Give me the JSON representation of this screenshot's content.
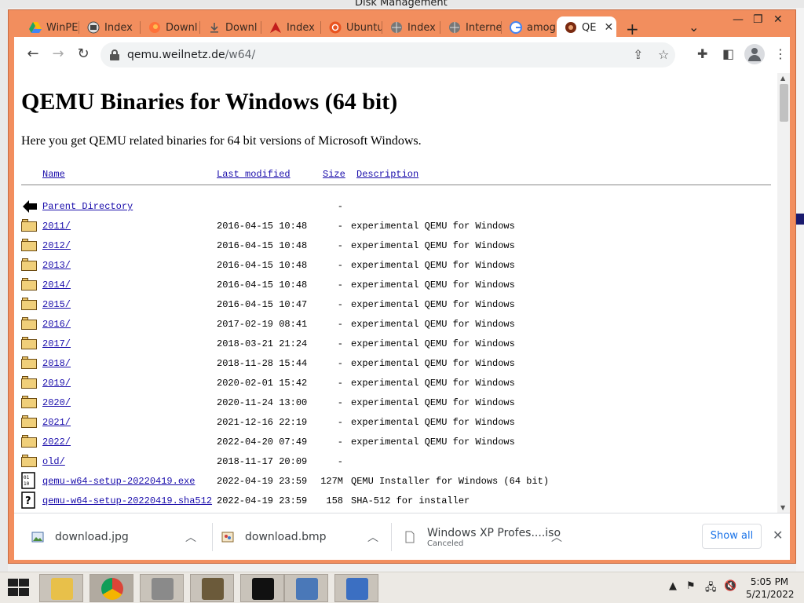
{
  "background_window": {
    "title": "Disk Management"
  },
  "browser": {
    "tabs": [
      {
        "label": "WinPE",
        "icon": "google-drive-icon"
      },
      {
        "label": "Index",
        "icon": "index-page-icon"
      },
      {
        "label": "Downl",
        "icon": "firefox-icon"
      },
      {
        "label": "Downl",
        "icon": "download-icon"
      },
      {
        "label": "Index",
        "icon": "arch-icon"
      },
      {
        "label": "Ubuntu",
        "icon": "ubuntu-icon"
      },
      {
        "label": "Index",
        "icon": "globe-icon"
      },
      {
        "label": "Interne",
        "icon": "globe-icon"
      },
      {
        "label": "amog",
        "icon": "google-icon"
      },
      {
        "label": "QE",
        "icon": "qemu-icon",
        "active": true
      }
    ],
    "address": {
      "host": "qemu.weilnetz.de",
      "path": "/w64/"
    }
  },
  "page": {
    "title": "QEMU Binaries for Windows (64 bit)",
    "intro": "Here you get QEMU related binaries for 64 bit versions of Microsoft Windows.",
    "columns": {
      "name": "Name",
      "modified": "Last modified",
      "size": "Size",
      "description": "Description"
    },
    "entries": [
      {
        "name": "Parent Directory",
        "date": "",
        "size": "-",
        "desc": "",
        "icon": "back-icon"
      },
      {
        "name": "2011/",
        "date": "2016-04-15 10:48",
        "size": "-",
        "desc": "experimental QEMU for Windows",
        "icon": "folder-icon"
      },
      {
        "name": "2012/",
        "date": "2016-04-15 10:48",
        "size": "-",
        "desc": "experimental QEMU for Windows",
        "icon": "folder-icon"
      },
      {
        "name": "2013/",
        "date": "2016-04-15 10:48",
        "size": "-",
        "desc": "experimental QEMU for Windows",
        "icon": "folder-icon"
      },
      {
        "name": "2014/",
        "date": "2016-04-15 10:48",
        "size": "-",
        "desc": "experimental QEMU for Windows",
        "icon": "folder-icon"
      },
      {
        "name": "2015/",
        "date": "2016-04-15 10:47",
        "size": "-",
        "desc": "experimental QEMU for Windows",
        "icon": "folder-icon"
      },
      {
        "name": "2016/",
        "date": "2017-02-19 08:41",
        "size": "-",
        "desc": "experimental QEMU for Windows",
        "icon": "folder-icon"
      },
      {
        "name": "2017/",
        "date": "2018-03-21 21:24",
        "size": "-",
        "desc": "experimental QEMU for Windows",
        "icon": "folder-icon"
      },
      {
        "name": "2018/",
        "date": "2018-11-28 15:44",
        "size": "-",
        "desc": "experimental QEMU for Windows",
        "icon": "folder-icon"
      },
      {
        "name": "2019/",
        "date": "2020-02-01 15:42",
        "size": "-",
        "desc": "experimental QEMU for Windows",
        "icon": "folder-icon"
      },
      {
        "name": "2020/",
        "date": "2020-11-24 13:00",
        "size": "-",
        "desc": "experimental QEMU for Windows",
        "icon": "folder-icon"
      },
      {
        "name": "2021/",
        "date": "2021-12-16 22:19",
        "size": "-",
        "desc": "experimental QEMU for Windows",
        "icon": "folder-icon"
      },
      {
        "name": "2022/",
        "date": "2022-04-20 07:49",
        "size": "-",
        "desc": "experimental QEMU for Windows",
        "icon": "folder-icon"
      },
      {
        "name": "old/",
        "date": "2018-11-17 20:09",
        "size": "-",
        "desc": "",
        "icon": "folder-icon"
      },
      {
        "name": "qemu-w64-setup-20220419.exe",
        "date": "2022-04-19 23:59",
        "size": "127M",
        "desc": "QEMU Installer for Windows (64 bit)",
        "icon": "binary-file-icon"
      },
      {
        "name": "qemu-w64-setup-20220419.sha512",
        "date": "2022-04-19 23:59",
        "size": "158",
        "desc": "SHA-512 for installer",
        "icon": "unknown-file-icon"
      }
    ]
  },
  "downloads": {
    "items": [
      {
        "filename": "download.jpg",
        "status": "",
        "icon": "image-file-icon"
      },
      {
        "filename": "download.bmp",
        "status": "",
        "icon": "paint-file-icon"
      },
      {
        "filename": "Windows XP Profes....iso",
        "status": "Canceled",
        "icon": "file-icon"
      }
    ],
    "show_all": "Show all"
  },
  "taskbar": {
    "apps": [
      {
        "name": "file-explorer-icon",
        "color": "#e8c04a"
      },
      {
        "name": "chrome-icon",
        "color": "#db4437"
      },
      {
        "name": "disk-management-icon",
        "color": "#8a8a8a"
      },
      {
        "name": "user-admin-icon",
        "color": "#6b5a3a"
      },
      {
        "name": "7zip-icon",
        "color": "#111111"
      },
      {
        "name": "image-viewer-icon",
        "color": "#4a78b8"
      },
      {
        "name": "virtualbox-icon",
        "color": "#3b6fc2"
      }
    ],
    "clock": {
      "time": "5:05 PM",
      "date": "5/21/2022"
    }
  },
  "colors": {
    "chrome_frame": "#f28e5e",
    "link": "#1a0dab",
    "show_all_text": "#1a73e8"
  }
}
